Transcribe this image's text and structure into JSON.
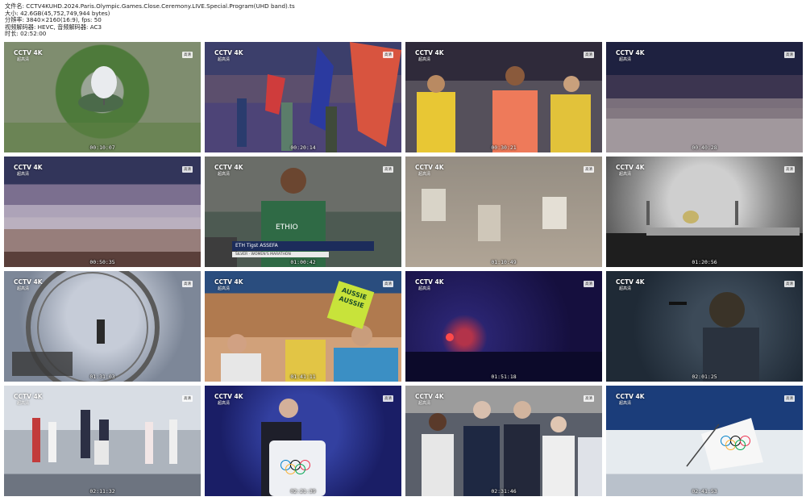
{
  "header": {
    "filename": "文件名: CCTV4KUHD.2024.Paris.Olympic.Games.Close.Ceremony.LIVE.Special.Program(UHD band).ts",
    "size": "大小: 42.6GB(45,752,749,944 bytes)",
    "resolution": "分辨率: 3840×2160(16:9), fps: 50",
    "codec": "视频解码器: HEVC, 音频解码器: AC3",
    "duration": "时长: 02:52:00"
  },
  "channel_logo": {
    "name": "CCTV 4K",
    "sub": "超高清"
  },
  "hd_badge": "高清",
  "thumbnails": [
    {
      "time": "00:10:07"
    },
    {
      "time": "00:20:14"
    },
    {
      "time": "00:30:21"
    },
    {
      "time": "00:40:28"
    },
    {
      "time": "00:50:35"
    },
    {
      "time": "01:00:42",
      "caption": "ETH  Tigst ASSEFA",
      "subcaption": "SILVER · WOMEN'S MARATHON",
      "shirt_text": "ETHIO"
    },
    {
      "time": "01:10:49"
    },
    {
      "time": "01:20:56"
    },
    {
      "time": "01:31:03"
    },
    {
      "time": "01:41:11",
      "sign_text": "AUSSIE AUSSIE"
    },
    {
      "time": "01:51:18"
    },
    {
      "time": "02:01:25"
    },
    {
      "time": "02:11:32"
    },
    {
      "time": "02:21:39"
    },
    {
      "time": "02:31:46"
    },
    {
      "time": "02:41:53"
    }
  ],
  "colors": {
    "ring_blue": "#0081c8",
    "ring_black": "#000000",
    "ring_red": "#ee334e",
    "ring_yellow": "#fcb131",
    "ring_green": "#00a651"
  }
}
